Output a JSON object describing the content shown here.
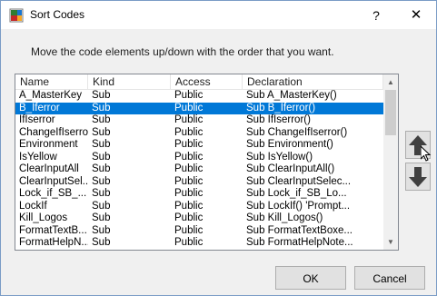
{
  "window": {
    "title": "Sort Codes",
    "help_label": "?",
    "close_label": "✕"
  },
  "instruction": "Move the code elements up/down with the order that you want.",
  "list": {
    "columns": [
      "Name",
      "Kind",
      "Access",
      "Declaration"
    ],
    "selected_index": 1,
    "rows": [
      [
        "A_MasterKey",
        "Sub",
        "Public",
        "Sub A_MasterKey()"
      ],
      [
        "B_Iferror",
        "Sub",
        "Public",
        "Sub B_Iferror()"
      ],
      [
        "IfIserror",
        "Sub",
        "Public",
        "Sub IfIserror()"
      ],
      [
        "ChangeIfIserror",
        "Sub",
        "Public",
        "Sub ChangeIfIserror()"
      ],
      [
        "Environment",
        "Sub",
        "Public",
        "Sub Environment()"
      ],
      [
        "IsYellow",
        "Sub",
        "Public",
        "Sub IsYellow()"
      ],
      [
        "ClearInputAll",
        "Sub",
        "Public",
        "Sub ClearInputAll()"
      ],
      [
        "ClearInputSel...",
        "Sub",
        "Public",
        "Sub ClearInputSelec..."
      ],
      [
        "Lock_if_SB_...",
        "Sub",
        "Public",
        "Sub Lock_if_SB_Lo..."
      ],
      [
        "LockIf",
        "Sub",
        "Public",
        "Sub LockIf()  'Prompt..."
      ],
      [
        "Kill_Logos",
        "Sub",
        "Public",
        "Sub Kill_Logos()"
      ],
      [
        "FormatTextB...",
        "Sub",
        "Public",
        "Sub FormatTextBoxe..."
      ],
      [
        "FormatHelpN...",
        "Sub",
        "Public",
        "Sub FormatHelpNote..."
      ]
    ]
  },
  "buttons": {
    "ok": "OK",
    "cancel": "Cancel"
  },
  "colors": {
    "selection": "#0078d7",
    "arrow_fill": "#404040",
    "button_face": "#e1e1e1"
  },
  "icons": {
    "app": "vba-app-icon",
    "move_up": "arrow-up-icon",
    "move_down": "arrow-down-icon",
    "cursor": "mouse-cursor-icon"
  }
}
